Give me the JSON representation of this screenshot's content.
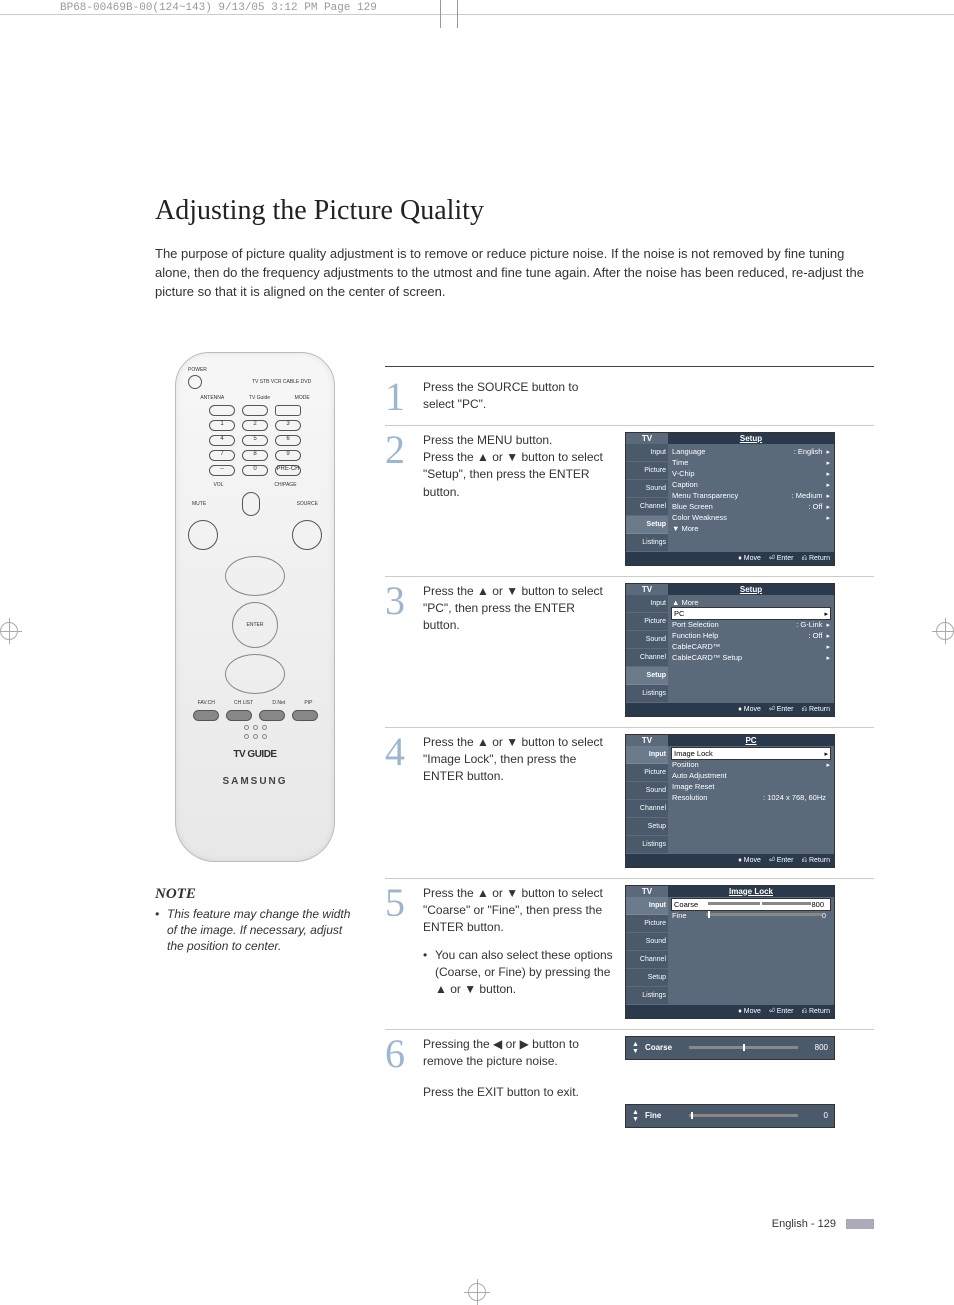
{
  "header_note": "BP68-00469B-00(124~143)  9/13/05  3:12 PM  Page 129",
  "title": "Adjusting the Picture Quality",
  "intro": "The purpose of picture quality adjustment is to remove or reduce picture noise. If the noise is not removed by fine tuning alone, then do the frequency adjustments to the utmost and fine tune again. After the noise has been reduced, re-adjust the picture so that it is aligned on the center of screen.",
  "remote": {
    "power": "POWER",
    "mode_labels": "TV  STB  VCR  CABLE  DVD",
    "row1": [
      "ANTENNA",
      "TV Guide",
      "MODE"
    ],
    "numbers": [
      [
        "1",
        "2",
        "3"
      ],
      [
        "4",
        "5",
        "6"
      ],
      [
        "7",
        "8",
        "9"
      ],
      [
        "–",
        "0",
        "PRE-CH"
      ]
    ],
    "vol": "VOL",
    "chpage": "CH/PAGE",
    "mute": "MUTE",
    "source": "SOURCE",
    "enter": "ENTER",
    "bottom": [
      "FAV.CH",
      "CH LIST",
      "D.Net",
      "PIP"
    ],
    "tvguide": "TV GUIDE",
    "brand": "SAMSUNG"
  },
  "note_h": "NOTE",
  "note_body": "This feature may change the width of the image. If necessary, adjust the position to center.",
  "steps": [
    {
      "n": "1",
      "text": "Press the SOURCE button to select \"PC\"."
    },
    {
      "n": "2",
      "text": "Press the MENU button.\nPress the ▲ or ▼ button to select \"Setup\", then press the ENTER button."
    },
    {
      "n": "3",
      "text": "Press the ▲ or ▼ button to select \"PC\", then press the ENTER button."
    },
    {
      "n": "4",
      "text": "Press the ▲ or ▼ button to select \"Image Lock\", then press the ENTER button."
    },
    {
      "n": "5",
      "text": "Press the ▲ or ▼ button to select \"Coarse\" or \"Fine\", then press the ENTER button.",
      "sub": "You can also select these options (Coarse, or Fine) by pressing the ▲ or ▼ button."
    },
    {
      "n": "6",
      "text": "Pressing the ◀ or ▶ button to remove the picture noise.",
      "extra": "Press the EXIT button to exit."
    }
  ],
  "osd_tabs": [
    "Input",
    "Picture",
    "Sound",
    "Channel",
    "Setup",
    "Listings"
  ],
  "osd_foot": {
    "move": "Move",
    "enter": "Enter",
    "return": "Return"
  },
  "osd2": {
    "tl": "TV",
    "tr": "Setup",
    "items": [
      {
        "l": "Language",
        "v": ": English",
        "a": true
      },
      {
        "l": "Time",
        "a": true
      },
      {
        "l": "V-Chip",
        "a": true
      },
      {
        "l": "Caption",
        "a": true
      },
      {
        "l": "Menu Transparency",
        "v": ": Medium",
        "a": true
      },
      {
        "l": "Blue Screen",
        "v": ": Off",
        "a": true
      },
      {
        "l": "Color Weakness",
        "a": true
      },
      {
        "l": "▼ More"
      }
    ]
  },
  "osd3": {
    "tl": "TV",
    "tr": "Setup",
    "items": [
      {
        "l": "▲ More"
      },
      {
        "l": "PC",
        "a": true,
        "hl": true
      },
      {
        "l": "Port Selection",
        "v": ": G-Link",
        "a": true
      },
      {
        "l": "Function Help",
        "v": ": Off",
        "a": true
      },
      {
        "l": "CableCARD™",
        "a": true
      },
      {
        "l": "CableCARD™ Setup",
        "a": true
      }
    ]
  },
  "osd4": {
    "tl": "TV",
    "tr": "PC",
    "items": [
      {
        "l": "Image Lock",
        "a": true,
        "hl": true
      },
      {
        "l": "Position",
        "a": true
      },
      {
        "l": "Auto Adjustment"
      },
      {
        "l": "Image Reset"
      },
      {
        "l": "Resolution",
        "v": ": 1024 x 768, 60Hz"
      }
    ]
  },
  "osd5": {
    "tl": "TV",
    "tr": "Image Lock",
    "items": [
      {
        "l": "Coarse",
        "slider": 50,
        "v": "800",
        "hl": true
      },
      {
        "l": "Fine",
        "slider": 2,
        "v": "0"
      }
    ]
  },
  "panel_coarse": {
    "label": "Coarse",
    "val": "800",
    "pos": 50
  },
  "panel_fine": {
    "label": "Fine",
    "val": "0",
    "pos": 2
  },
  "footer": "English - 129"
}
